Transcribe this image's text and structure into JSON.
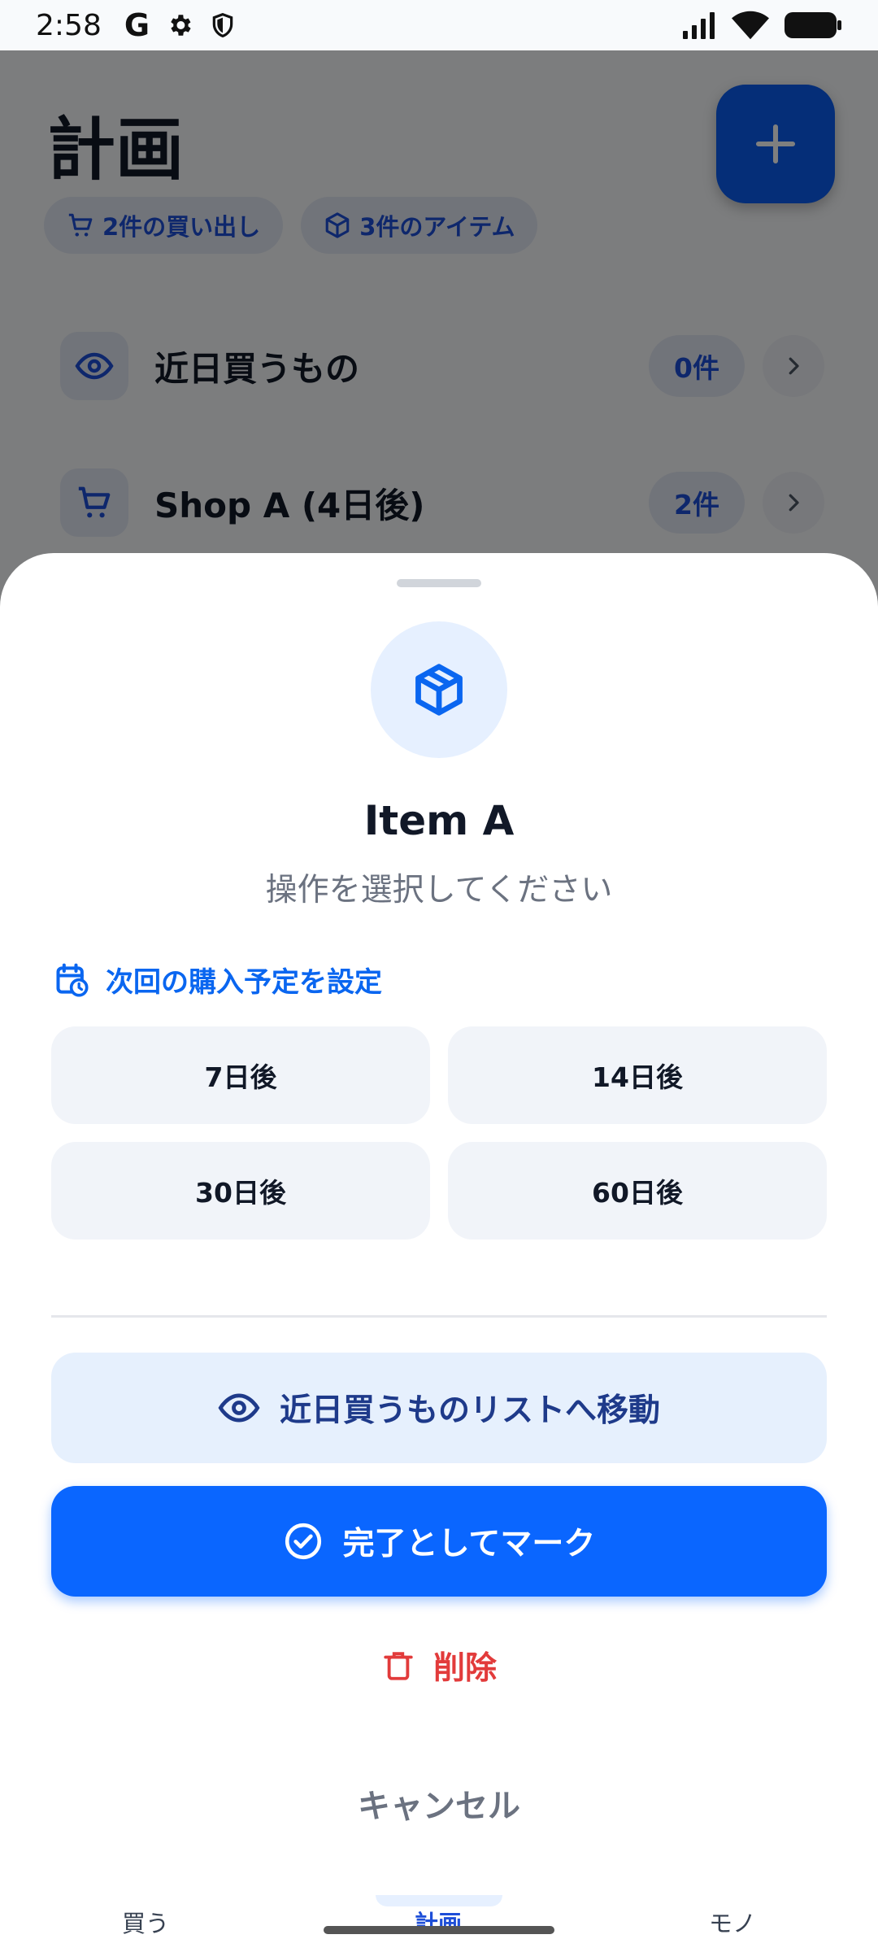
{
  "status_bar": {
    "time": "2:58",
    "left_icons": [
      "google-icon",
      "gear-icon",
      "shield-icon"
    ],
    "right_icons": [
      "signal-icon",
      "wifi-icon",
      "battery-icon"
    ]
  },
  "background": {
    "title": "計画",
    "chips": [
      {
        "icon": "cart-icon",
        "label": "2件の買い出し"
      },
      {
        "icon": "box-icon",
        "label": "3件のアイテム"
      }
    ],
    "list": [
      {
        "icon": "eye-icon",
        "label": "近日買うもの",
        "count": "0件"
      },
      {
        "icon": "cart-icon",
        "label": "Shop A (4日後)",
        "count": "2件"
      }
    ]
  },
  "sheet": {
    "item_icon": "box-icon",
    "title": "Item A",
    "subtitle": "操作を選択してください",
    "schedule_header": "次回の購入予定を設定",
    "schedule_options": [
      "7日後",
      "14日後",
      "30日後",
      "60日後"
    ],
    "move_label": "近日買うものリストへ移動",
    "complete_label": "完了としてマーク",
    "delete_label": "削除",
    "cancel_label": "キャンセル"
  },
  "bottom_nav": {
    "items": [
      {
        "label": "買う",
        "active": false
      },
      {
        "label": "計画",
        "active": true
      },
      {
        "label": "モノ",
        "active": false
      }
    ]
  },
  "colors": {
    "primary": "#0a66ff",
    "primary_soft": "#e6f0fd",
    "danger": "#e23b3b",
    "text": "#111827",
    "muted": "#6b7280"
  }
}
